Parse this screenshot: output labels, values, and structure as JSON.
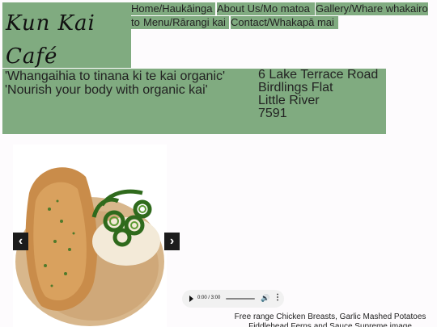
{
  "brand": {
    "name": "Kun Kai Café",
    "colors": {
      "green": "#80ab80",
      "background": "#fdfbfd",
      "arrow_bg": "#1c1c1c"
    }
  },
  "nav": {
    "items": [
      {
        "label": "Home/Haukāinga"
      },
      {
        "label": "About Us/Mo matoa"
      },
      {
        "label": "Gallery/Whare whakairo"
      },
      {
        "label": "Menu/Rārangi kai"
      },
      {
        "label": "Contact/Whakapā mai"
      }
    ]
  },
  "taglines": [
    "'Whangaihia to tinana ki te kai organic'",
    "'Nourish your body with organic kai'"
  ],
  "address": {
    "line1": "6 Lake Terrace Road",
    "line2": "Birdlings Flat",
    "line3": "Little River",
    "line4": "7591"
  },
  "slideshow": {
    "prev_icon": "chevron-left-icon",
    "next_icon": "chevron-right-icon",
    "prev_glyph": "‹",
    "next_glyph": "›"
  },
  "audio": {
    "time": "0:00 / 3:00",
    "play_icon": "play-icon",
    "volume_icon": "volume-icon",
    "more_icon": "more-options-icon"
  },
  "caption": {
    "text": "Free range Chicken Breasts, Garlic Mashed Potatoes Fiddlehead Ferns and Sauce Supreme image"
  }
}
